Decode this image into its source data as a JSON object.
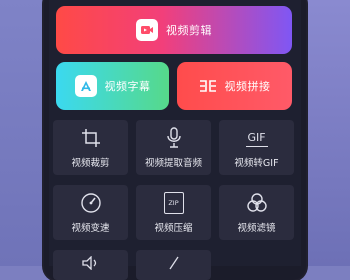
{
  "main_button": {
    "label": "视频剪辑",
    "icon": "video-clip-icon"
  },
  "secondary_buttons": [
    {
      "label": "视频字幕",
      "icon": "subtitle-icon"
    },
    {
      "label": "视频拼接",
      "icon": "join-icon"
    }
  ],
  "tools": [
    {
      "label": "视频裁剪",
      "icon": "crop-icon"
    },
    {
      "label": "视频提取音频",
      "icon": "microphone-icon"
    },
    {
      "label": "视频转GIF",
      "icon": "gif-icon",
      "icon_text": "GIF"
    },
    {
      "label": "视频变速",
      "icon": "speedometer-icon"
    },
    {
      "label": "视频压缩",
      "icon": "zip-icon",
      "icon_text": "ZIP"
    },
    {
      "label": "视频滤镜",
      "icon": "filter-icon"
    }
  ],
  "colors": {
    "main_gradient": [
      "#ff4a46",
      "#7f57f4"
    ],
    "subtitle_gradient": [
      "#3bd9f0",
      "#56d98a"
    ],
    "join_color": "#ff4c4c",
    "tile": "#2b2c3e",
    "screen": "#1e2030"
  }
}
